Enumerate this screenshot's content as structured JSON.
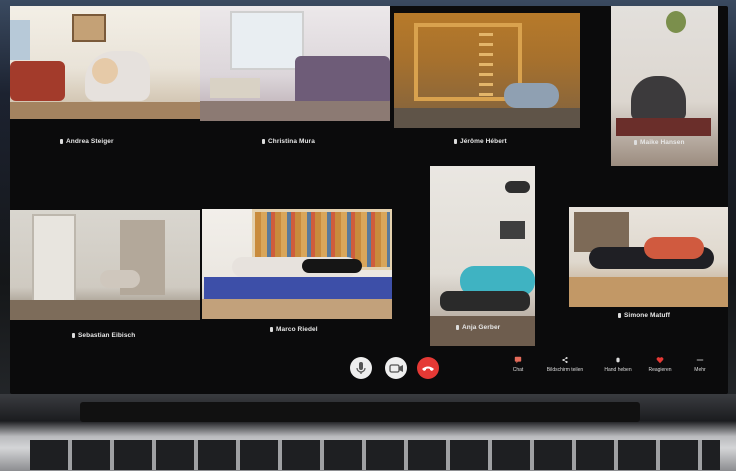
{
  "participants": [
    {
      "name": "Andrea Steiger"
    },
    {
      "name": "Christina Mura"
    },
    {
      "name": "Jérôme Hébert"
    },
    {
      "name": "Maike Hansen"
    },
    {
      "name": "Sebastian Eibisch"
    },
    {
      "name": "Marco Riedel"
    },
    {
      "name": "Anja Gerber"
    },
    {
      "name": "Simone Matuff"
    }
  ],
  "toolbar": {
    "chat_label": "Chat",
    "share_label": "Bildschirm teilen",
    "hand_label": "Hand heben",
    "react_label": "Reagieren",
    "more_label": "Mehr"
  },
  "colors": {
    "hangup": "#e53935",
    "react_heart": "#e53935"
  },
  "icons": {
    "mic": "microphone-icon",
    "camera": "camera-icon",
    "hangup": "hang-up-icon",
    "chat": "chat-icon",
    "share": "share-screen-icon",
    "hand": "raise-hand-icon",
    "react": "heart-icon",
    "more": "more-icon"
  }
}
